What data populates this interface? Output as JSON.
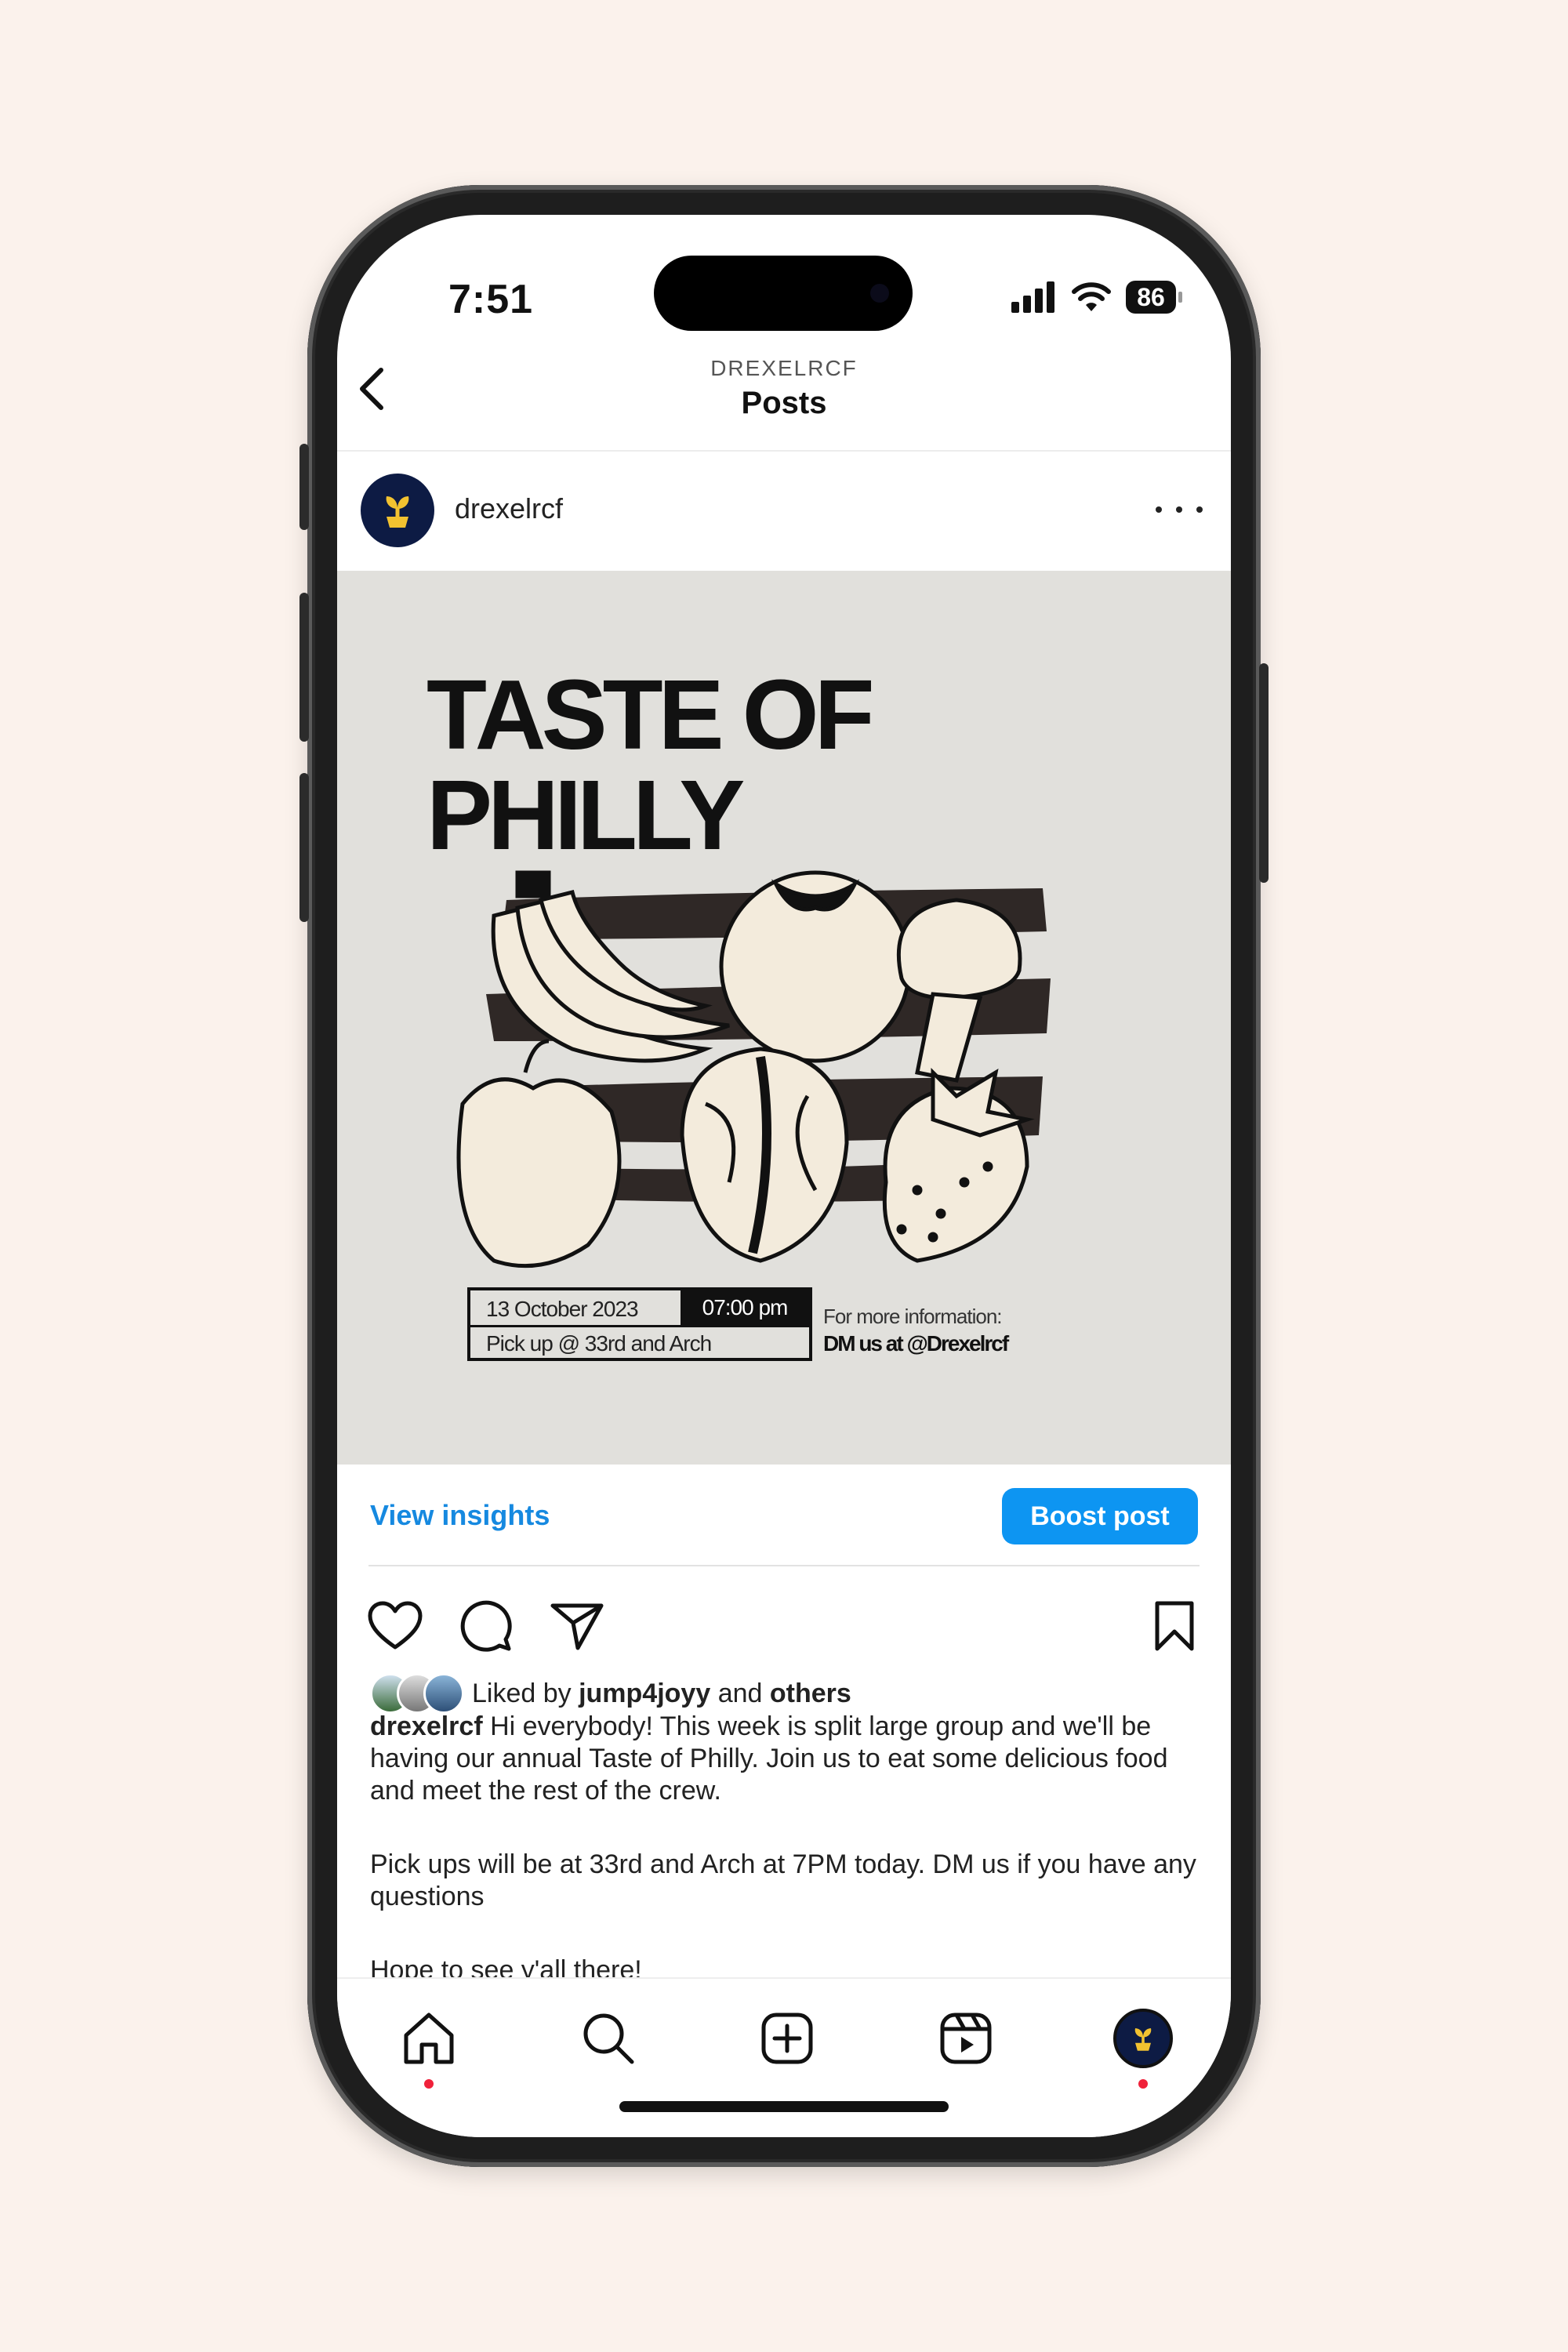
{
  "status": {
    "time": "7:51",
    "battery": "86"
  },
  "header": {
    "account": "DREXELRCF",
    "title": "Posts"
  },
  "post": {
    "username": "drexelrcf",
    "poster": {
      "title": "TASTE OF PHILLY",
      "date": "13 October 2023",
      "time": "07:00 pm",
      "location": "Pick up @ 33rd and Arch",
      "more_info": "For more information:",
      "dm": "DM us at @Drexelrcf"
    },
    "view_insights": "View insights",
    "boost_post": "Boost post",
    "likes": {
      "prefix": "Liked by",
      "user": "jump4joyy",
      "and": "and",
      "others": "others"
    },
    "caption": {
      "user": "drexelrcf",
      "text1": "Hi everybody! This week is split large group and we'll be having our annual Taste of Philly. Join us to eat some delicious food and meet the rest of the crew.",
      "text2": "Pick ups will be at 33rd and Arch at 7PM today. DM us if you have any questions",
      "text3": "Hope to see y'all there!"
    }
  },
  "colors": {
    "accent": "#0d95f2",
    "link": "#1689e0",
    "notification_dot": "#f0213a",
    "avatar_bg": "#0d1b44"
  },
  "icons": [
    "back-arrow-icon",
    "more-options-icon",
    "heart-icon",
    "comment-icon",
    "share-icon",
    "bookmark-icon",
    "home-icon",
    "search-icon",
    "create-icon",
    "reels-icon",
    "profile-icon"
  ]
}
